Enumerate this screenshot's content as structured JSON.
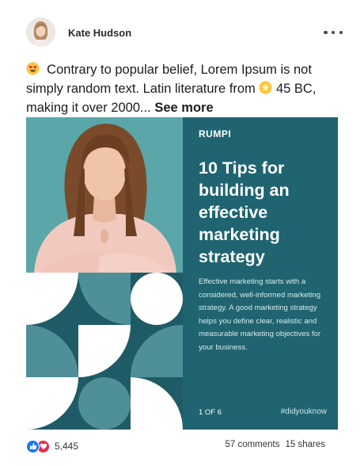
{
  "post": {
    "author": "Kate Hudson",
    "text_line1": "Contrary to popular belief, Lorem Ipsum is not simply random text. Latin literature from",
    "text_line2": "45 BC, making it over 2000...",
    "see_more": "See more"
  },
  "slide": {
    "brand": "RUMPI",
    "headline": "10 Tips for building an effective marketing strategy",
    "body": "Effective marketing starts with a considered, well-informed marketing strategy. A good marketing strategy helps you define clear, realistic and measurable marketing objectives for your business.",
    "page": "1 OF 6",
    "hashtag": "#didyouknow"
  },
  "engagement": {
    "reaction_count": "5,445",
    "comments": "57 comments",
    "shares": "15 shares"
  },
  "icons": [
    "avatar",
    "more-options-icon",
    "heart-eyes-emoji-icon",
    "star-emoji-icon",
    "like-reaction-icon",
    "love-reaction-icon"
  ],
  "colors": {
    "panel": "#1f6470",
    "pattern_dark": "#1f5b66",
    "pattern_mid": "#4f8f98",
    "pattern_light": "#ffffff",
    "photo_bg": "#5aa6a8",
    "like": "#1877f2",
    "love": "#f0284a"
  }
}
